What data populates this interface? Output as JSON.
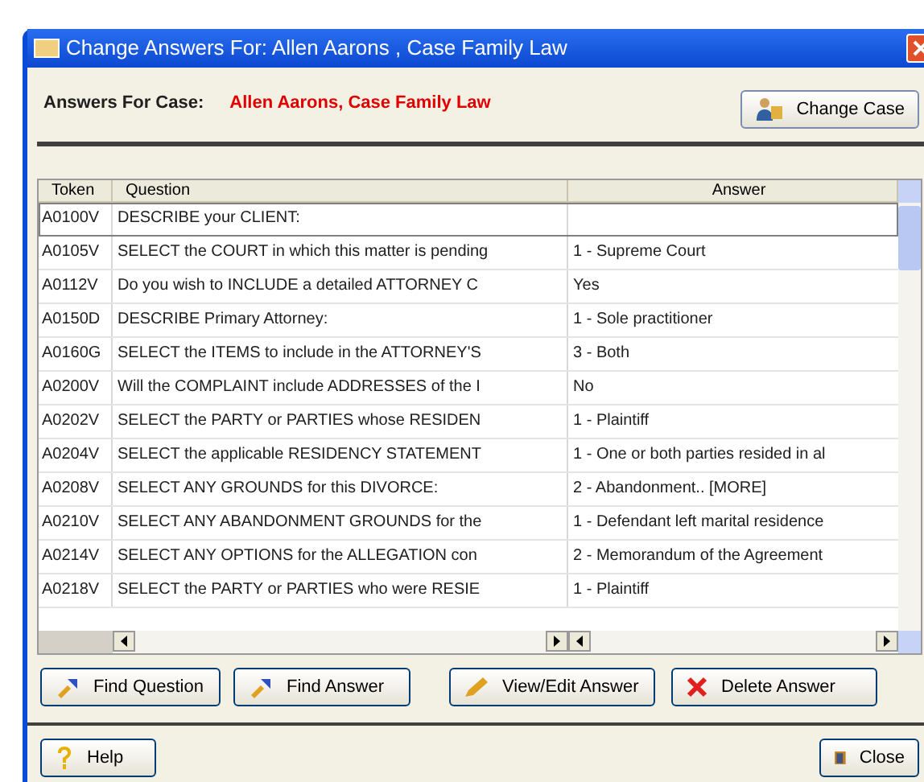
{
  "window": {
    "title": "Change Answers For: Allen Aarons , Case Family Law"
  },
  "header": {
    "label": "Answers For Case:",
    "case_name": "Allen Aarons, Case Family Law",
    "button": "Change Case"
  },
  "table": {
    "columns": [
      "Token",
      "Question",
      "Answer"
    ],
    "rows": [
      {
        "token": "A0100V",
        "question": "DESCRIBE your CLIENT:",
        "answer": "",
        "selected": true
      },
      {
        "token": "A0105V",
        "question": "SELECT the COURT in which this matter is pending",
        "answer": "1 - Supreme Court",
        "selected": false
      },
      {
        "token": "A0112V",
        "question": "Do you wish to INCLUDE a detailed ATTORNEY C",
        "answer": "Yes",
        "selected": false
      },
      {
        "token": "A0150D",
        "question": "DESCRIBE Primary Attorney:",
        "answer": "1 - Sole practitioner",
        "selected": false
      },
      {
        "token": "A0160G",
        "question": "SELECT the ITEMS to include in the ATTORNEY'S",
        "answer": "3 - Both",
        "selected": false
      },
      {
        "token": "A0200V",
        "question": "Will the COMPLAINT include ADDRESSES of the I",
        "answer": "No",
        "selected": false
      },
      {
        "token": "A0202V",
        "question": "SELECT the PARTY or PARTIES whose RESIDEN",
        "answer": "1 - Plaintiff",
        "selected": false
      },
      {
        "token": "A0204V",
        "question": "SELECT the applicable RESIDENCY STATEMENT",
        "answer": "1 - One or both parties resided in al",
        "selected": false
      },
      {
        "token": "A0208V",
        "question": "SELECT ANY GROUNDS for this DIVORCE:",
        "answer": "2 - Abandonment.. [MORE]",
        "selected": false
      },
      {
        "token": "A0210V",
        "question": "SELECT ANY ABANDONMENT GROUNDS for the",
        "answer": "1 - Defendant left marital residence",
        "selected": false
      },
      {
        "token": "A0214V",
        "question": "SELECT ANY OPTIONS for the ALLEGATION con",
        "answer": "2 - Memorandum of the Agreement",
        "selected": false
      },
      {
        "token": "A0218V",
        "question": "SELECT the PARTY or PARTIES who were RESIE",
        "answer": "1 - Plaintiff",
        "selected": false
      }
    ]
  },
  "actions": [
    {
      "kind": "find",
      "label": "Find Question"
    },
    {
      "kind": "find",
      "label": "Find Answer"
    },
    {
      "kind": "edit",
      "label": "View/Edit Answer"
    },
    {
      "kind": "delete",
      "label": "Delete Answer"
    }
  ],
  "footer": [
    {
      "kind": "help",
      "label": "Help"
    },
    {
      "kind": "close",
      "label": "Close"
    }
  ]
}
